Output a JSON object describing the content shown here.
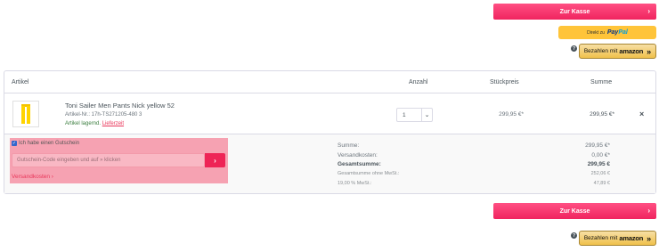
{
  "top_actions": {
    "checkout_label": "Zur Kasse",
    "checkout_chevron": "›",
    "paypal_prefix": "Direkt zu",
    "paypal_logo_pay": "Pay",
    "paypal_logo_pal": "Pal",
    "help_icon": "?",
    "amazon_prefix": "Bezahlen mit",
    "amazon_logo": "amazon",
    "amazon_arrows": "»"
  },
  "cart": {
    "columns": {
      "article": "Artikel",
      "quantity": "Anzahl",
      "unit_price": "Stückpreis",
      "total": "Summe"
    },
    "item": {
      "name": "Toni Sailer Men Pants Nick yellow 52",
      "sku": "Artikel-Nr.: 17h-TS271205-480 3",
      "stock_label": "Artikel lagernd.",
      "delivery_link": "Lieferzeit",
      "quantity": "1",
      "unit_price": "299,95 €*",
      "total_price": "299,95 €*",
      "remove_icon": "×",
      "image_color": "#ffd400"
    },
    "voucher": {
      "checkbox_label": "Ich habe einen Gutschein",
      "checkbox_mark": "✓",
      "input_placeholder": "Gutschein-Code eingeben und auf » klicken",
      "submit_icon": "›",
      "shipping_link": "Versandkosten ›"
    },
    "summary": [
      {
        "label": "Summe:",
        "value": "299,95 €*",
        "style": "normal"
      },
      {
        "label": "Versandkosten:",
        "value": "0,00 €*",
        "style": "normal"
      },
      {
        "label": "Gesamtsumme:",
        "value": "299,95 €",
        "style": "bold"
      },
      {
        "label": "Gesamtsumme ohne MwSt.:",
        "value": "252,06 €",
        "style": "small"
      },
      {
        "label": "19,00 % MwSt.:",
        "value": "47,89 €",
        "style": "small"
      }
    ]
  },
  "bottom_actions": {
    "checkout_label": "Zur Kasse",
    "checkout_chevron": "›",
    "help_icon": "?",
    "amazon_prefix": "Bezahlen mit",
    "amazon_logo": "amazon",
    "amazon_arrows": "»"
  },
  "colors": {
    "accent": "#f0245f",
    "paypal": "#ffc439",
    "amazon": "#f0c14b",
    "voucher_highlight": "#f6a2b2"
  }
}
